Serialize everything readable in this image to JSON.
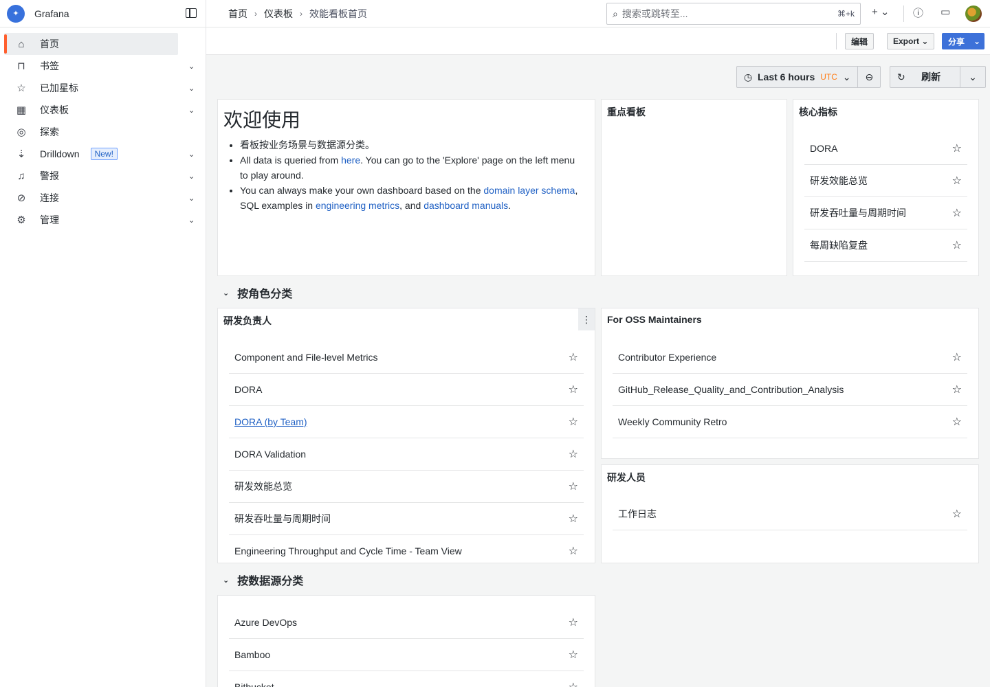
{
  "app": {
    "name": "Grafana"
  },
  "sidebar": {
    "items": [
      {
        "label": "首页",
        "icon": "home-icon"
      },
      {
        "label": "书签",
        "icon": "bookmark-icon"
      },
      {
        "label": "已加星标",
        "icon": "star-icon"
      },
      {
        "label": "仪表板",
        "icon": "apps-icon"
      },
      {
        "label": "探索",
        "icon": "compass-icon"
      },
      {
        "label": "Drilldown",
        "icon": "drilldown-icon",
        "badge": "New!"
      },
      {
        "label": "警报",
        "icon": "bell-icon"
      },
      {
        "label": "连接",
        "icon": "link-icon"
      },
      {
        "label": "管理",
        "icon": "cog-icon"
      }
    ]
  },
  "breadcrumb": {
    "home": "首页",
    "dashboards": "仪表板",
    "current": "效能看板首页"
  },
  "search": {
    "placeholder": "搜索或跳转至...",
    "shortcut": "⌘+k"
  },
  "toolbar": {
    "edit": "编辑",
    "export": "Export",
    "share": "分享"
  },
  "time": {
    "range": "Last 6 hours",
    "tz": "UTC",
    "refresh": "刷新"
  },
  "welcome": {
    "title": "欢迎使用",
    "bullet1": "看板按业务场景与数据源分类。",
    "b2_pre": "All data is queried from ",
    "b2_link": "here",
    "b2_post": ". You can go to the 'Explore' page on the left menu to play around.",
    "b3_pre": "You can always make your own dashboard based on the ",
    "b3_link1": "domain layer schema",
    "b3_mid1": ", SQL examples in ",
    "b3_link2": "engineering metrics",
    "b3_mid2": ", and ",
    "b3_link3": "dashboard manuals",
    "b3_end": "."
  },
  "panels": {
    "focus": {
      "title": "重点看板"
    },
    "core": {
      "title": "核心指标",
      "items": [
        "DORA",
        "研发效能总览",
        "研发吞吐量与周期时间",
        "每周缺陷复盘"
      ]
    },
    "lead": {
      "title": "研发负责人",
      "items": [
        "Component and File-level Metrics",
        "DORA",
        "DORA (by Team)",
        "DORA Validation",
        "研发效能总览",
        "研发吞吐量与周期时间",
        "Engineering Throughput and Cycle Time - Team View"
      ]
    },
    "oss": {
      "title": "For OSS Maintainers",
      "items": [
        "Contributor Experience",
        "GitHub_Release_Quality_and_Contribution_Analysis",
        "Weekly Community Retro"
      ]
    },
    "dev": {
      "title": "研发人员",
      "items": [
        "工作日志"
      ]
    },
    "source": {
      "items": [
        "Azure DevOps",
        "Bamboo",
        "Bitbucket"
      ]
    }
  },
  "rows": {
    "by_role": "按角色分类",
    "by_source": "按数据源分类"
  }
}
